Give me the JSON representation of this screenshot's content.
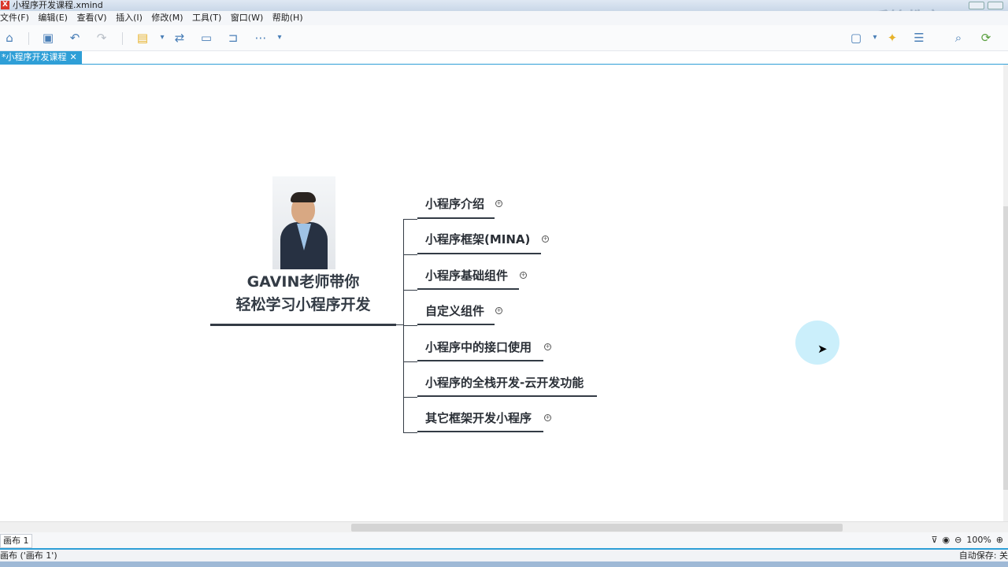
{
  "window": {
    "title": "小程序开发课程.xmind",
    "watermark": "千锋教育"
  },
  "menu": [
    "文件(F)",
    "编辑(E)",
    "查看(V)",
    "插入(I)",
    "修改(M)",
    "工具(T)",
    "窗口(W)",
    "帮助(H)"
  ],
  "tab": {
    "label": "*小程序开发课程",
    "close": "✕"
  },
  "mindmap": {
    "central_line1": "GAVIN老师带你",
    "central_line2": "轻松学习小程序开发",
    "topics": [
      {
        "label": "小程序介绍",
        "collapsed": true
      },
      {
        "label": "小程序框架(MINA)",
        "collapsed": true
      },
      {
        "label": "小程序基础组件",
        "collapsed": true
      },
      {
        "label": "自定义组件",
        "collapsed": true
      },
      {
        "label": "小程序中的接口使用",
        "collapsed": true
      },
      {
        "label": "小程序的全栈开发-云开发功能",
        "collapsed": false
      },
      {
        "label": "其它框架开发小程序",
        "collapsed": true
      }
    ]
  },
  "sheetbar": {
    "sheet": "画布 1",
    "zoom": "100%"
  },
  "statusbar": {
    "left": "画布 ('画布 1')",
    "right": "自动保存: 关"
  },
  "colors": {
    "accent": "#2f9fd7",
    "topic_line": "#333b45"
  }
}
